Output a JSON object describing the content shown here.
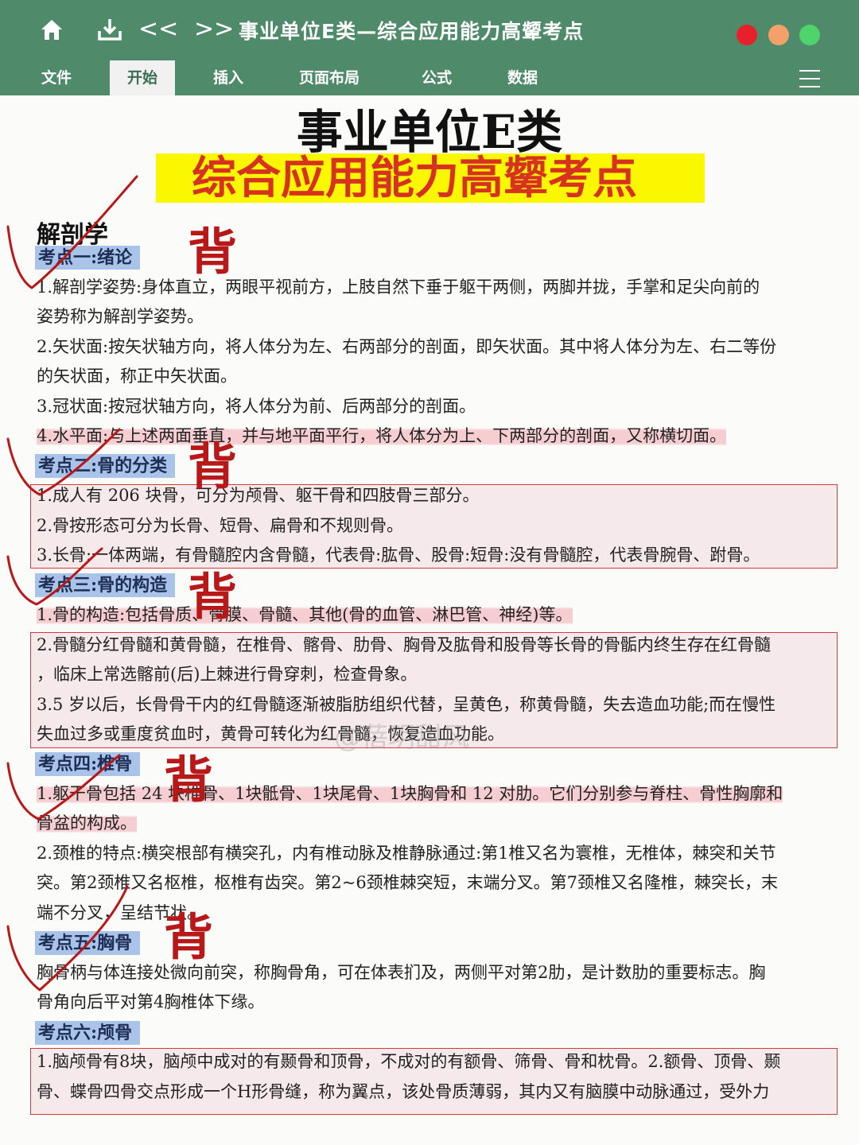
{
  "toolbar": {
    "title": "事业单位E类—综合应用能力高颦考点",
    "icons": [
      "home-icon",
      "download-icon",
      "back-icon",
      "forward-icon"
    ],
    "back_glyph": "<<",
    "forward_glyph": ">>",
    "window_dots": [
      "#e8202a",
      "#f4a06a",
      "#4fd36b"
    ]
  },
  "menu": [
    "文件",
    "开始",
    "插入",
    "页面布局",
    "公式",
    "数据"
  ],
  "menu_active": "开始",
  "doc": {
    "title": "事业单位E类",
    "subtitle": "综合应用能力高颦考点",
    "section": "解剖学",
    "annotation": "背",
    "watermark": "@蓓玥甜风",
    "kp1": "考点一:绪论",
    "kp1_l1": "1.解剖学姿势:身体直立，两眼平视前方，上肢自然下垂于躯干两侧，两脚并拢，手掌和足尖向前的",
    "kp1_l2": "姿势称为解剖学姿势。",
    "kp1_l3": "2.矢状面:按矢状轴方向，将人体分为左、右两部分的剖面，即矢状面。其中将人体分为左、右二等份",
    "kp1_l4": "的矢状面，称正中矢状面。",
    "kp1_l5": "3.冠状面:按冠状轴方向，将人体分为前、后两部分的剖面。",
    "kp1_l6": "4.水平面:与上述两面垂直，并与地平面平行，将人体分为上、下两部分的剖面，又称横切面。",
    "kp2": "考点二:骨的分类",
    "kp2_l1": "1.成人有 206 块骨，可分为颅骨、躯干骨和四肢骨三部分。",
    "kp2_l2": "2.骨按形态可分为长骨、短骨、扁骨和不规则骨。",
    "kp2_l3": "3.长骨:一体两端，有骨髓腔内含骨髓，代表骨:肱骨、股骨:短骨:没有骨髓腔，代表骨腕骨、跗骨。",
    "kp3": "考点三:骨的构造",
    "kp3_l1": "1.骨的构造:包括骨质、骨膜、骨髓、其他(骨的血管、淋巴管、神经)等。",
    "kp3_l2": "2.骨髓分红骨髓和黄骨髓，在椎骨、髂骨、肋骨、胸骨及肱骨和股骨等长骨的骨骺内终生存在红骨髓",
    "kp3_l3": "，临床上常选髂前(后)上棘进行骨穿刺，检查骨象。",
    "kp3_l4": "3.5 岁以后，长骨骨干内的红骨髓逐渐被脂肪组织代替，呈黄色，称黄骨髓，失去造血功能;而在慢性",
    "kp3_l5": "失血过多或重度贫血时，黄骨可转化为红骨髓，恢复造血功能。",
    "kp4": "考点四:椎骨",
    "kp4_l1": "1.躯干骨包括 24 块椎骨、1块骶骨、1块尾骨、1块胸骨和 12 对肋。它们分别参与脊柱、骨性胸廓和",
    "kp4_l2": "骨盆的构成。",
    "kp4_l3": "2.颈椎的特点:横突根部有横突孔，内有椎动脉及椎静脉通过:第1椎又名为寰椎，无椎体，棘突和关节",
    "kp4_l4": "突。第2颈椎又名枢椎，枢椎有齿突。第2~6颈椎棘突短，末端分叉。第7颈椎又名隆椎，棘突长，末",
    "kp4_l5": "端不分叉，呈结节状。",
    "kp5": "考点五:胸骨",
    "kp5_l1": "胸骨柄与体连接处微向前突，称胸骨角，可在体表扪及，两侧平对第2肋，是计数肋的重要标志。胸",
    "kp5_l2": "骨角向后平对第4胸椎体下缘。",
    "kp6": "考点六:颅骨",
    "kp6_l1": "1.脑颅骨有8块，脑颅中成对的有颞骨和顶骨，不成对的有额骨、筛骨、骨和枕骨。2.额骨、顶骨、颞",
    "kp6_l2": "骨、蝶骨四骨交点形成一个H形骨缝，称为翼点，该处骨质薄弱，其内又有脑膜中动脉通过，受外力"
  }
}
